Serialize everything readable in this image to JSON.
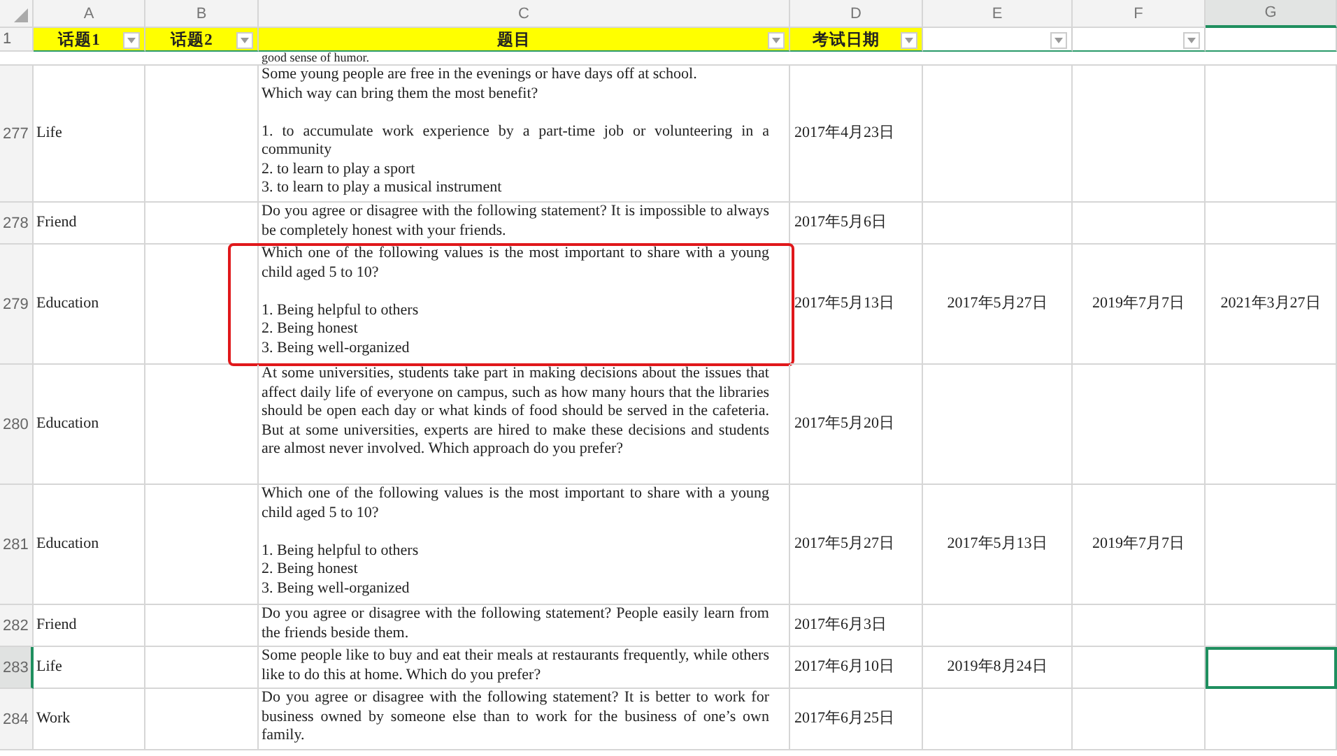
{
  "columns": [
    {
      "letter": "A",
      "selected": false
    },
    {
      "letter": "B",
      "selected": false
    },
    {
      "letter": "C",
      "selected": false
    },
    {
      "letter": "D",
      "selected": false
    },
    {
      "letter": "E",
      "selected": false
    },
    {
      "letter": "F",
      "selected": false
    },
    {
      "letter": "G",
      "selected": true
    }
  ],
  "header_row": {
    "number": "1",
    "cells": [
      {
        "label": "话题1",
        "highlighted": true,
        "filter": true
      },
      {
        "label": "话题2",
        "highlighted": true,
        "filter": true
      },
      {
        "label": "题目",
        "highlighted": true,
        "filter": true
      },
      {
        "label": "考试日期",
        "highlighted": true,
        "filter": true
      },
      {
        "highlighted": false,
        "filter": true
      },
      {
        "highlighted": false,
        "filter": true
      },
      {
        "highlighted": false,
        "filter": false
      }
    ]
  },
  "partial_row": {
    "text": "good sense of humor."
  },
  "rows": [
    {
      "number": "277",
      "topic1": "Life",
      "question": "Some young people are free in the evenings or have days off at school.\nWhich way can bring them the most benefit?\n\n1. to accumulate work experience by a part-time job or volunteering in a community\n2. to learn to play a sport\n3. to learn to play a musical instrument",
      "dates": {
        "d": "2017年4月23日"
      },
      "highlighted": false,
      "selected": false
    },
    {
      "number": "278",
      "topic1": "Friend",
      "question": "Do you agree or disagree with the following statement? It is impossible to always be completely honest with your friends.",
      "dates": {
        "d": "2017年5月6日"
      },
      "highlighted": false,
      "selected": false
    },
    {
      "number": "279",
      "topic1": "Education",
      "question": "Which one of the following values is the most important to share with a young child aged 5 to 10?\n\n1. Being helpful to others\n2. Being honest\n3. Being well-organized",
      "dates": {
        "d": "2017年5月13日",
        "e": "2017年5月27日",
        "f": "2019年7月7日",
        "g": "2021年3月27日"
      },
      "highlighted": true,
      "selected": false
    },
    {
      "number": "280",
      "topic1": "Education",
      "question": "At some universities, students take part in making decisions about the issues that affect daily life of everyone on campus, such as how many hours that the libraries should be open each day or what kinds of food should be served in the cafeteria. But at some universities, experts are hired to make these decisions and students are almost never involved. Which approach do you prefer?",
      "dates": {
        "d": "2017年5月20日"
      },
      "highlighted": false,
      "selected": false
    },
    {
      "number": "281",
      "topic1": "Education",
      "question": "Which one of the following values is the most important to share with a young child aged 5 to 10?\n\n1. Being helpful to others\n2. Being honest\n3. Being well-organized",
      "dates": {
        "d": "2017年5月27日",
        "e": "2017年5月13日",
        "f": "2019年7月7日"
      },
      "highlighted": false,
      "selected": false
    },
    {
      "number": "282",
      "topic1": "Friend",
      "question": "Do you agree or disagree with the following statement? People easily learn from the friends beside them.",
      "dates": {
        "d": "2017年6月3日"
      },
      "highlighted": false,
      "selected": false
    },
    {
      "number": "283",
      "topic1": "Life",
      "question": "Some people like to buy and eat their meals at restaurants frequently, while others like to do this at home. Which do you prefer?",
      "dates": {
        "d": "2017年6月10日",
        "e": "2019年8月24日"
      },
      "highlighted": false,
      "selected": true
    },
    {
      "number": "284",
      "topic1": "Work",
      "question": "Do you agree or disagree with the following statement? It is better to work for business owned by someone else than to work for the business of one’s own family.",
      "dates": {
        "d": "2017年6月25日"
      },
      "highlighted": false,
      "selected": false
    }
  ]
}
